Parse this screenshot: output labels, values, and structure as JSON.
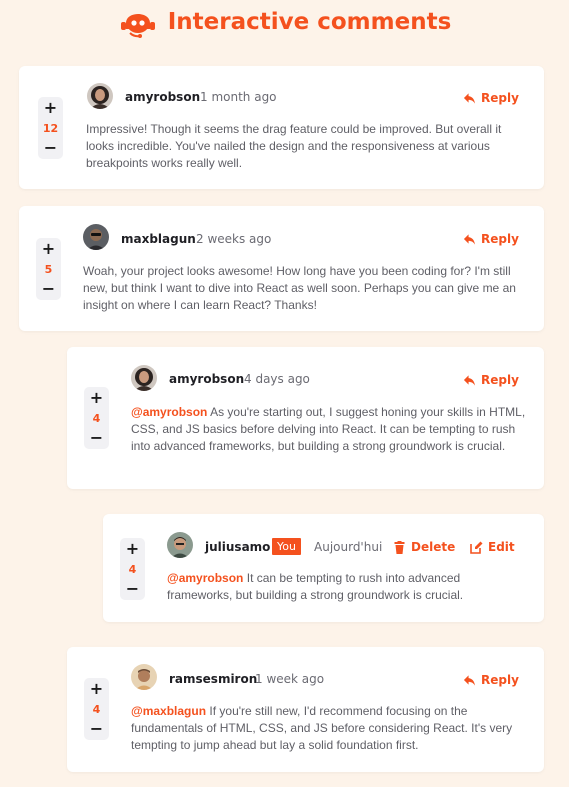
{
  "header": {
    "title": "Interactive comments",
    "logo_icon": "support-agent-icon",
    "accent_color": "#f4511e"
  },
  "comments": [
    {
      "username": "amyrobson",
      "time": "1 month ago",
      "score": "12",
      "avatar": "avatar-amyrobson",
      "reply_label": "Reply",
      "text": "Impressive! Though it seems the drag feature could be improved. But overall it looks incredible. You've nailed the design and the responsiveness at various breakpoints works really well."
    },
    {
      "username": "maxblagun",
      "time": "2 weeks ago",
      "score": "5",
      "avatar": "avatar-maxblagun",
      "reply_label": "Reply",
      "text": "Woah, your project looks awesome! How long have you been coding for? I'm still new, but think I want to dive into React as well soon. Perhaps you can give me an insight on where I can learn React? Thanks!"
    },
    {
      "username": "amyrobson",
      "time": "4 days ago",
      "score": "4",
      "avatar": "avatar-amyrobson",
      "reply_label": "Reply",
      "mention": "@amyrobson",
      "text": "As you're starting out, I suggest honing your skills in HTML, CSS, and JS basics before delving into React. It can be tempting to rush into advanced frameworks, but building a strong groundwork is crucial."
    },
    {
      "username": "juliusamo",
      "you_badge": "You",
      "time": "Aujourd'hui",
      "score": "4",
      "avatar": "avatar-juliusamo",
      "delete_label": "Delete",
      "edit_label": "Edit",
      "mention": "@amyrobson",
      "text": "It can be tempting to rush into advanced frameworks, but building a strong groundwork is crucial."
    },
    {
      "username": "ramsesmiron",
      "time": "1 week ago",
      "score": "4",
      "avatar": "avatar-ramsesmiron",
      "reply_label": "Reply",
      "mention": "@maxblagun",
      "text": "If you're still new, I'd recommend focusing on the fundamentals of HTML, CSS, and JS before considering React. It's very tempting to jump ahead but lay a solid foundation first."
    }
  ],
  "vote": {
    "plus": "+",
    "minus": "−"
  }
}
